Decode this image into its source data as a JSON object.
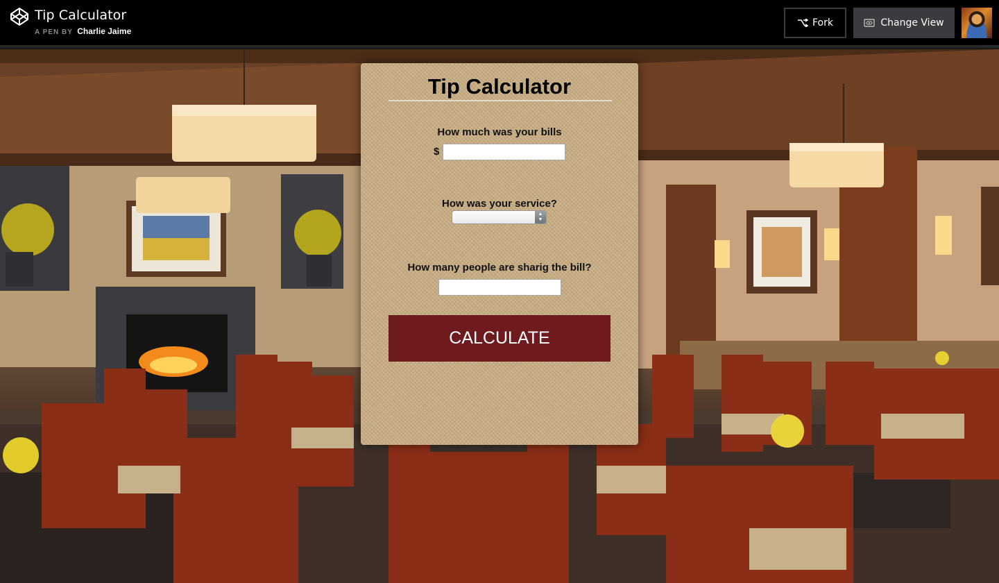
{
  "header": {
    "title": "Tip Calculator",
    "byline_prefix": "A PEN BY",
    "author": "Charlie Jaime",
    "fork_label": "Fork",
    "change_view_label": "Change View"
  },
  "calculator": {
    "title": "Tip Calculator",
    "bill_label": "How much was your bills",
    "currency_symbol": "$",
    "bill_value": "",
    "service_label": "How was your service?",
    "service_selected": "",
    "people_label": "How many people are sharig the bill?",
    "people_value": "",
    "calculate_label": "CALCULATE"
  },
  "colors": {
    "accent_button": "#6e1a1f",
    "card": "#c8ad82",
    "topbar": "#000000"
  },
  "icons": {
    "logo": "codepen-logo-icon",
    "fork": "fork-icon",
    "change_view": "eye-box-icon"
  }
}
